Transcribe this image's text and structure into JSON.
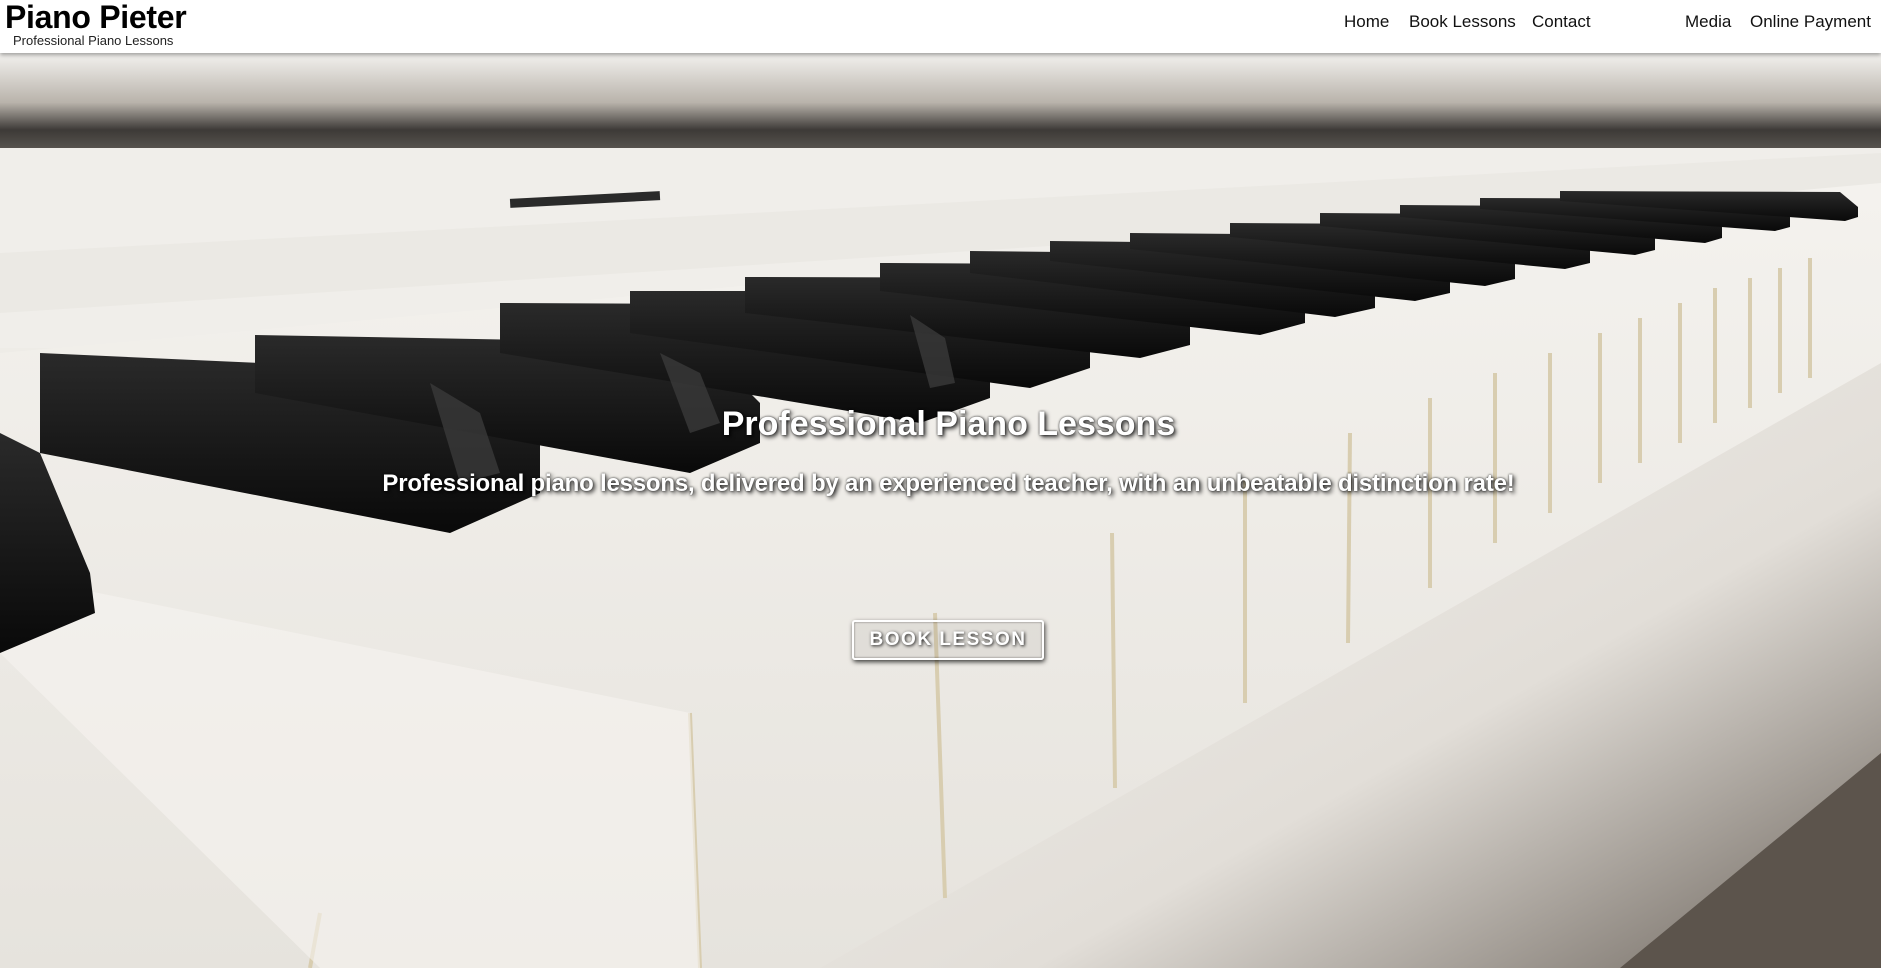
{
  "brand": {
    "title": "Piano Pieter",
    "subtitle": "Professional Piano Lessons"
  },
  "nav": {
    "items": [
      {
        "label": "Home"
      },
      {
        "label": "Book Lessons"
      },
      {
        "label": "Contact"
      },
      {
        "label": "Media"
      },
      {
        "label": "Online Payment"
      }
    ]
  },
  "hero": {
    "title": "Professional Piano Lessons",
    "subtitle": "Professional piano lessons, delivered by an experienced teacher, with an unbeatable distinction rate!",
    "button_label": "BOOK LESSON",
    "background": "piano-keys-photo"
  },
  "colors": {
    "nav_bg": "#ffffff",
    "text_dark": "#000000",
    "hero_text": "#ffffff",
    "key_white": "#f1efea",
    "key_black": "#151515"
  }
}
